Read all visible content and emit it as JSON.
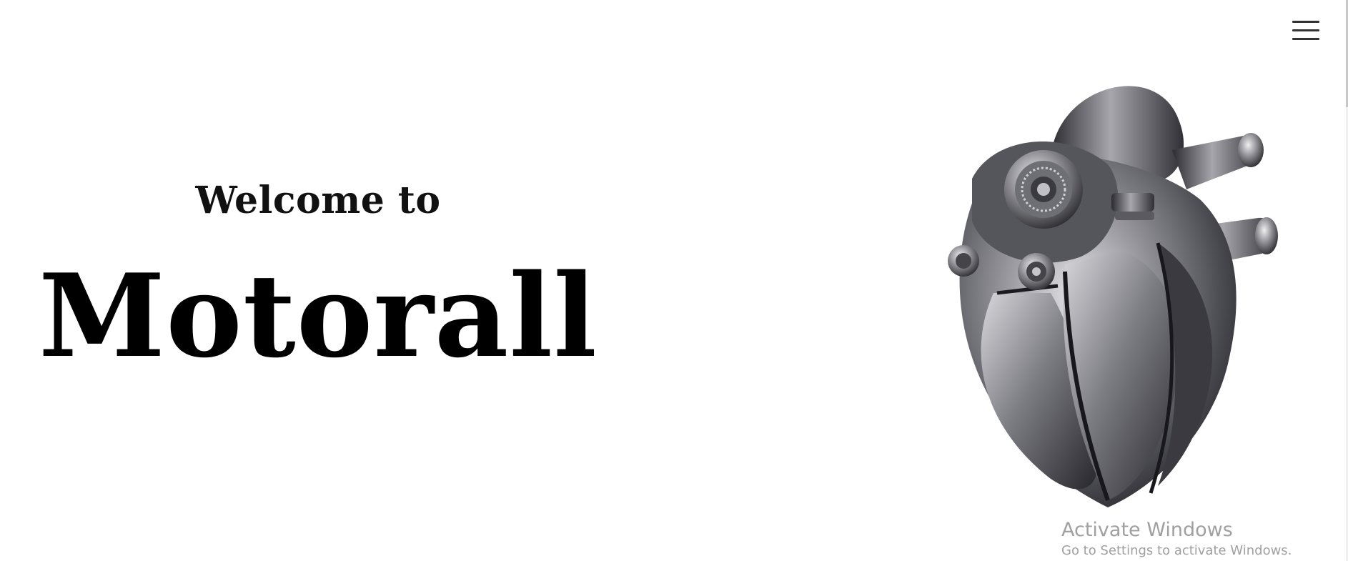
{
  "header": {
    "menu_icon": "hamburger-menu-icon"
  },
  "hero": {
    "welcome_text": "Welcome to",
    "brand_name": "Motorall",
    "image": "mechanical-heart-image"
  },
  "watermark": {
    "title": "Activate Windows",
    "subtitle": "Go to Settings to activate Windows."
  },
  "colors": {
    "background": "#ffffff",
    "text": "#000000",
    "watermark": "#a0a0a0",
    "metal_dark": "#2e2e33",
    "metal_light": "#d9d9dd"
  }
}
